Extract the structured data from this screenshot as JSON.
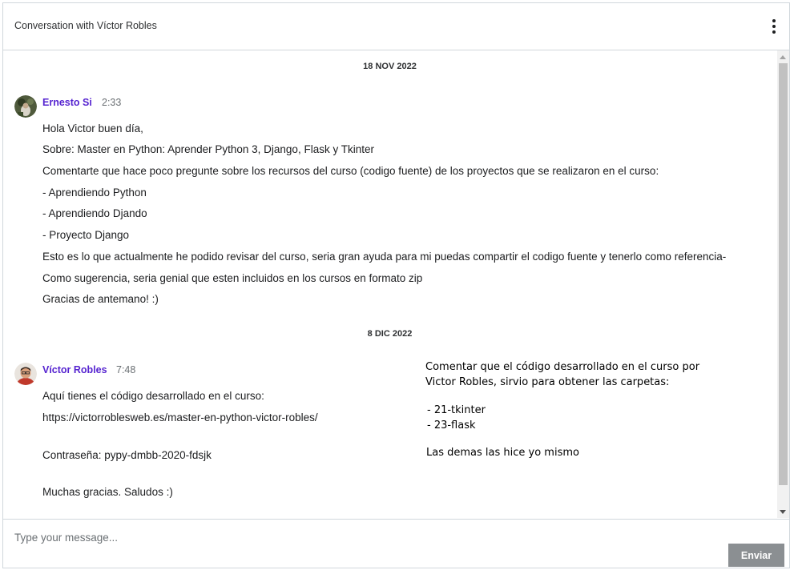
{
  "header": {
    "title": "Conversation with Víctor Robles",
    "menu_icon": "kebab-menu-icon"
  },
  "messages": [
    {
      "date": "18 NOV 2022",
      "sender": "Ernesto Si",
      "time": "2:33",
      "lines": [
        "Hola Victor buen día,",
        "Sobre: Master en Python: Aprender Python 3, Django, Flask y Tkinter",
        "Comentarte que hace poco pregunte sobre los recursos del curso (codigo fuente) de los proyectos que se realizaron en el curso:",
        "- Aprendiendo Python",
        "- Aprendiendo Djando",
        "- Proyecto Django",
        "Esto es lo que actualmente he podido revisar del curso, seria gran ayuda para mi puedas compartir el codigo fuente y tenerlo como referencia-",
        "Como sugerencia, seria genial que esten incluidos en los cursos en formato zip",
        "Gracias de antemano! :)"
      ]
    },
    {
      "date": "8 DIC 2022",
      "sender": "Víctor Robles",
      "time": "7:48",
      "lines": [
        "Aquí tienes el código desarrollado en el curso:",
        "https://victorroblesweb.es/master-en-python-victor-robles/",
        "Contraseña: pypy-dmbb-2020-fdsjk",
        "Muchas gracias. Saludos :)"
      ]
    }
  ],
  "note": {
    "lines": [
      "Comentar que el código desarrollado en el curso por",
      "Victor Robles, sirvio para obtener las carpetas:",
      "- 21-tkinter",
      "- 23-flask",
      "Las demas las hice yo mismo"
    ]
  },
  "composer": {
    "placeholder": "Type your message...",
    "send_label": "Enviar"
  }
}
